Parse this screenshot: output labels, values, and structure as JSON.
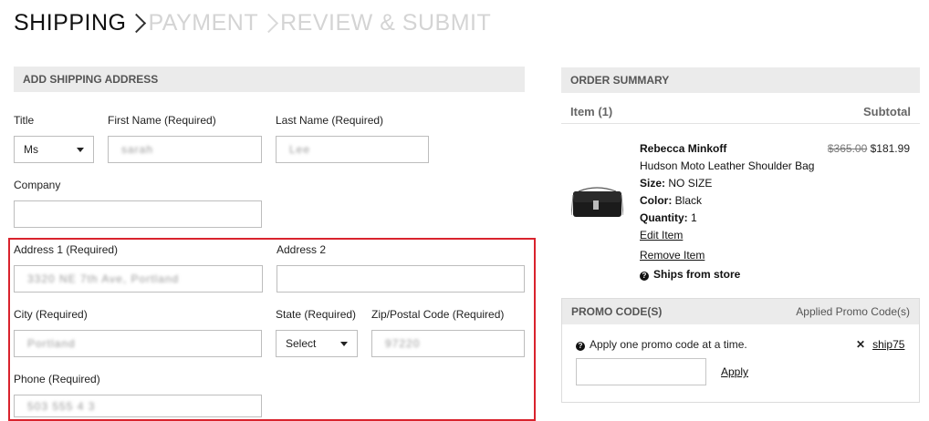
{
  "checkout_steps": {
    "shipping": "SHIPPING",
    "payment": "PAYMENT",
    "review": "REVIEW & SUBMIT"
  },
  "shipping_form": {
    "header": "ADD SHIPPING ADDRESS",
    "title_label": "Title",
    "title_value": "Ms",
    "first_name_label": "First Name (Required)",
    "first_name_value": "sarah",
    "last_name_label": "Last Name (Required)",
    "last_name_value": "Lee",
    "company_label": "Company",
    "company_value": "",
    "address1_label": "Address 1 (Required)",
    "address1_value": "3320 NE 7th Ave, Portland",
    "address2_label": "Address 2",
    "address2_value": "",
    "city_label": "City (Required)",
    "city_value": "Portland",
    "state_label": "State (Required)",
    "state_value": "Select",
    "zip_label": "Zip/Postal Code (Required)",
    "zip_value": "97220",
    "phone_label": "Phone (Required)",
    "phone_value": "503 555 4 3"
  },
  "order_summary": {
    "header": "ORDER SUMMARY",
    "item_count_label": "Item (1)",
    "subtotal_label": "Subtotal",
    "product": {
      "brand": "Rebecca Minkoff",
      "name": "Hudson Moto Leather Shoulder Bag",
      "size_label": "Size:",
      "size_value": "NO SIZE",
      "color_label": "Color:",
      "color_value": "Black",
      "quantity_label": "Quantity:",
      "quantity_value": "1",
      "original_price": "$365.00",
      "sale_price": "$181.99",
      "edit_link": "Edit Item",
      "remove_link": "Remove Item",
      "ships_from": "Ships from store"
    }
  },
  "promo": {
    "header": "PROMO CODE(S)",
    "applied_header": "Applied Promo Code(s)",
    "note": "Apply one promo code at a time.",
    "input_value": "",
    "apply_label": "Apply",
    "applied_code": "ship75"
  },
  "colors": {
    "highlight_border": "#d9232d",
    "section_bar_bg": "#ebebeb",
    "inactive_step": "#d4d4d4"
  }
}
